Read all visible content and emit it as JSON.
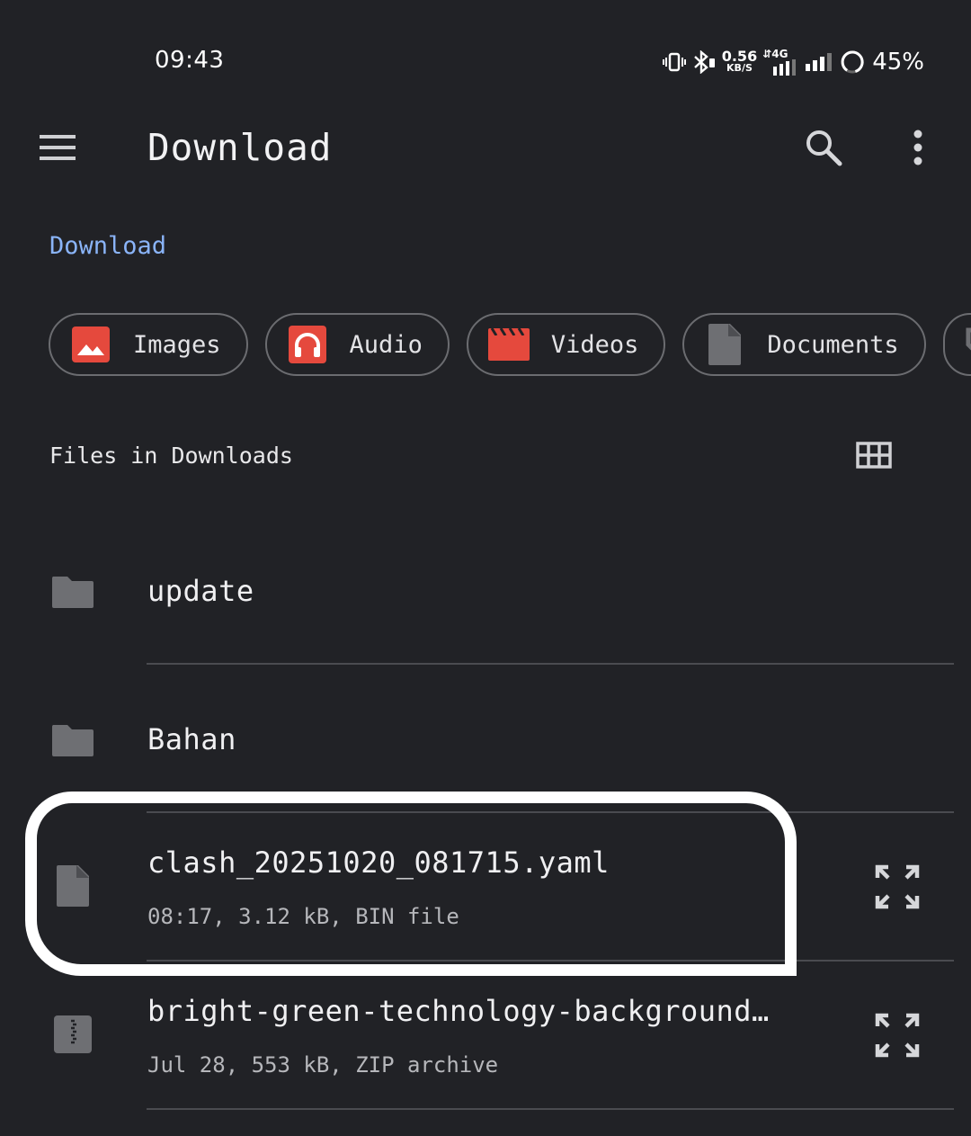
{
  "status_bar": {
    "time": "09:43",
    "net_speed_value": "0.56",
    "net_speed_unit": "KB/S",
    "network_type": "4G",
    "battery_percent": "45%",
    "icons": [
      "vibrate-icon",
      "bluetooth-icon",
      "signal-4g-icon",
      "signal-icon",
      "battery-ring-icon"
    ]
  },
  "app_bar": {
    "title": "Download",
    "icons": [
      "menu-icon",
      "search-icon",
      "more-vert-icon"
    ]
  },
  "breadcrumb": {
    "label": "Download"
  },
  "chips": [
    {
      "label": "Images",
      "icon": "image-icon",
      "color": "#e5493d"
    },
    {
      "label": "Audio",
      "icon": "headphones-icon",
      "color": "#e5493d"
    },
    {
      "label": "Videos",
      "icon": "movie-icon",
      "color": "#e5493d"
    },
    {
      "label": "Documents",
      "icon": "document-icon",
      "color": "#6e6f73"
    },
    {
      "label": "",
      "icon": "label-tag-icon",
      "color": "#6e6f73"
    }
  ],
  "section": {
    "header": "Files in Downloads",
    "view_toggle_icon": "grid-view-icon"
  },
  "files": [
    {
      "name": "update",
      "icon": "folder-icon"
    },
    {
      "name": "Bahan",
      "icon": "folder-icon"
    },
    {
      "name": "clash_20251020_081715.yaml",
      "details": "08:17, 3.12 kB, BIN file",
      "icon": "file-icon",
      "action_icon": "expand-icon"
    },
    {
      "name": "bright-green-technology-background…",
      "details": "Jul 28, 553 kB, ZIP archive",
      "icon": "zip-file-icon",
      "action_icon": "expand-icon"
    }
  ]
}
